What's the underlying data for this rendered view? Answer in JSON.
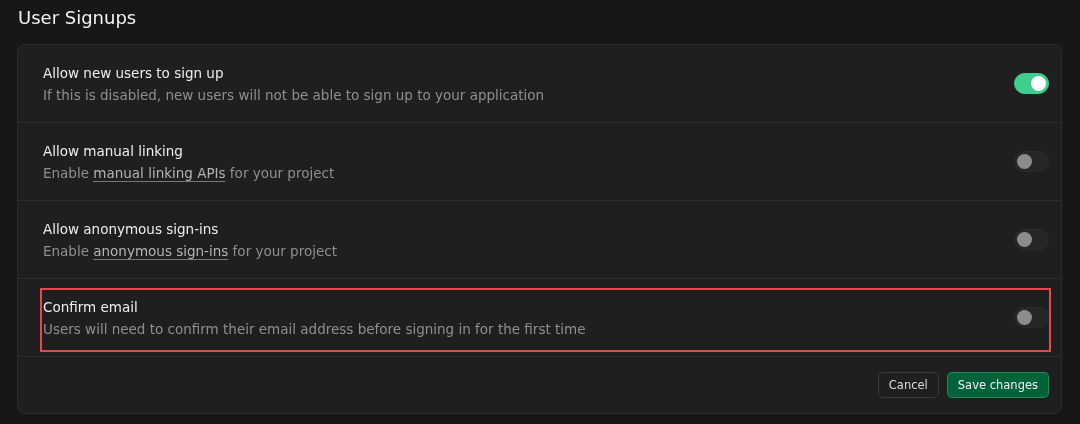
{
  "title": "User Signups",
  "settings": [
    {
      "label": "Allow new users to sign up",
      "description": [
        {
          "text": "If this is disabled, new users will not be able to sign up to your application",
          "kind": "text"
        }
      ],
      "on": true,
      "highlighted": false
    },
    {
      "label": "Allow manual linking",
      "description": [
        {
          "text": "Enable ",
          "kind": "text"
        },
        {
          "text": "manual linking APIs",
          "kind": "link"
        },
        {
          "text": " for your project",
          "kind": "text"
        }
      ],
      "on": false,
      "highlighted": false
    },
    {
      "label": "Allow anonymous sign-ins",
      "description": [
        {
          "text": "Enable ",
          "kind": "text"
        },
        {
          "text": "anonymous sign-ins",
          "kind": "link"
        },
        {
          "text": " for your project",
          "kind": "text"
        }
      ],
      "on": false,
      "highlighted": false
    },
    {
      "label": "Confirm email",
      "description": [
        {
          "text": "Users will need to confirm their email address before signing in for the first time",
          "kind": "text"
        }
      ],
      "on": false,
      "highlighted": true
    }
  ],
  "buttons": [
    {
      "label": "Cancel",
      "kind": "secondary"
    },
    {
      "label": "Save changes",
      "kind": "primary"
    }
  ]
}
